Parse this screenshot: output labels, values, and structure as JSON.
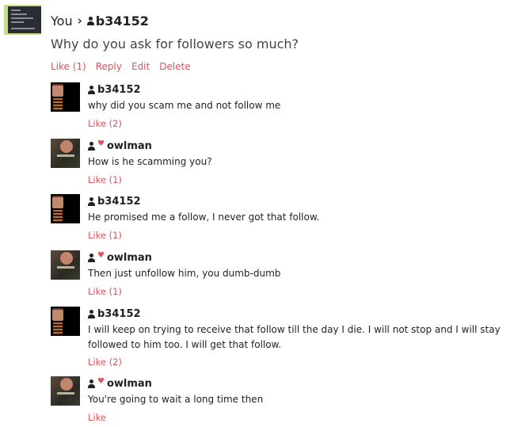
{
  "top_comment": {
    "author": "You",
    "target_user": "b34152",
    "text": "Why do you ask for followers so much?",
    "actions": [
      "Like (1)",
      "Reply",
      "Edit",
      "Delete"
    ]
  },
  "replies": [
    {
      "user": "b34152",
      "avatar": "b34152",
      "owner_badge": false,
      "text": "why did you scam me and not follow me",
      "like": "Like (2)"
    },
    {
      "user": "owlman",
      "avatar": "owlman",
      "owner_badge": true,
      "text": "How is he scamming you?",
      "like": "Like (1)"
    },
    {
      "user": "b34152",
      "avatar": "b34152",
      "owner_badge": false,
      "text": "He promised me a follow, I never got that follow.",
      "like": "Like (1)"
    },
    {
      "user": "owlman",
      "avatar": "owlman",
      "owner_badge": true,
      "text": "Then just unfollow him, you dumb-dumb",
      "like": "Like (1)"
    },
    {
      "user": "b34152",
      "avatar": "b34152",
      "owner_badge": false,
      "text": "I will keep on trying to receive that follow till the day I die. I will not stop and I will stay followed to him too. I will get that follow.",
      "like": "Like (2)"
    },
    {
      "user": "owlman",
      "avatar": "owlman",
      "owner_badge": true,
      "text": "You're going to wait a long time then",
      "like": "Like"
    }
  ],
  "colors": {
    "action_red": "#e0525a",
    "text_dark": "#222222",
    "top_thumb_green": "#c5e27a"
  }
}
